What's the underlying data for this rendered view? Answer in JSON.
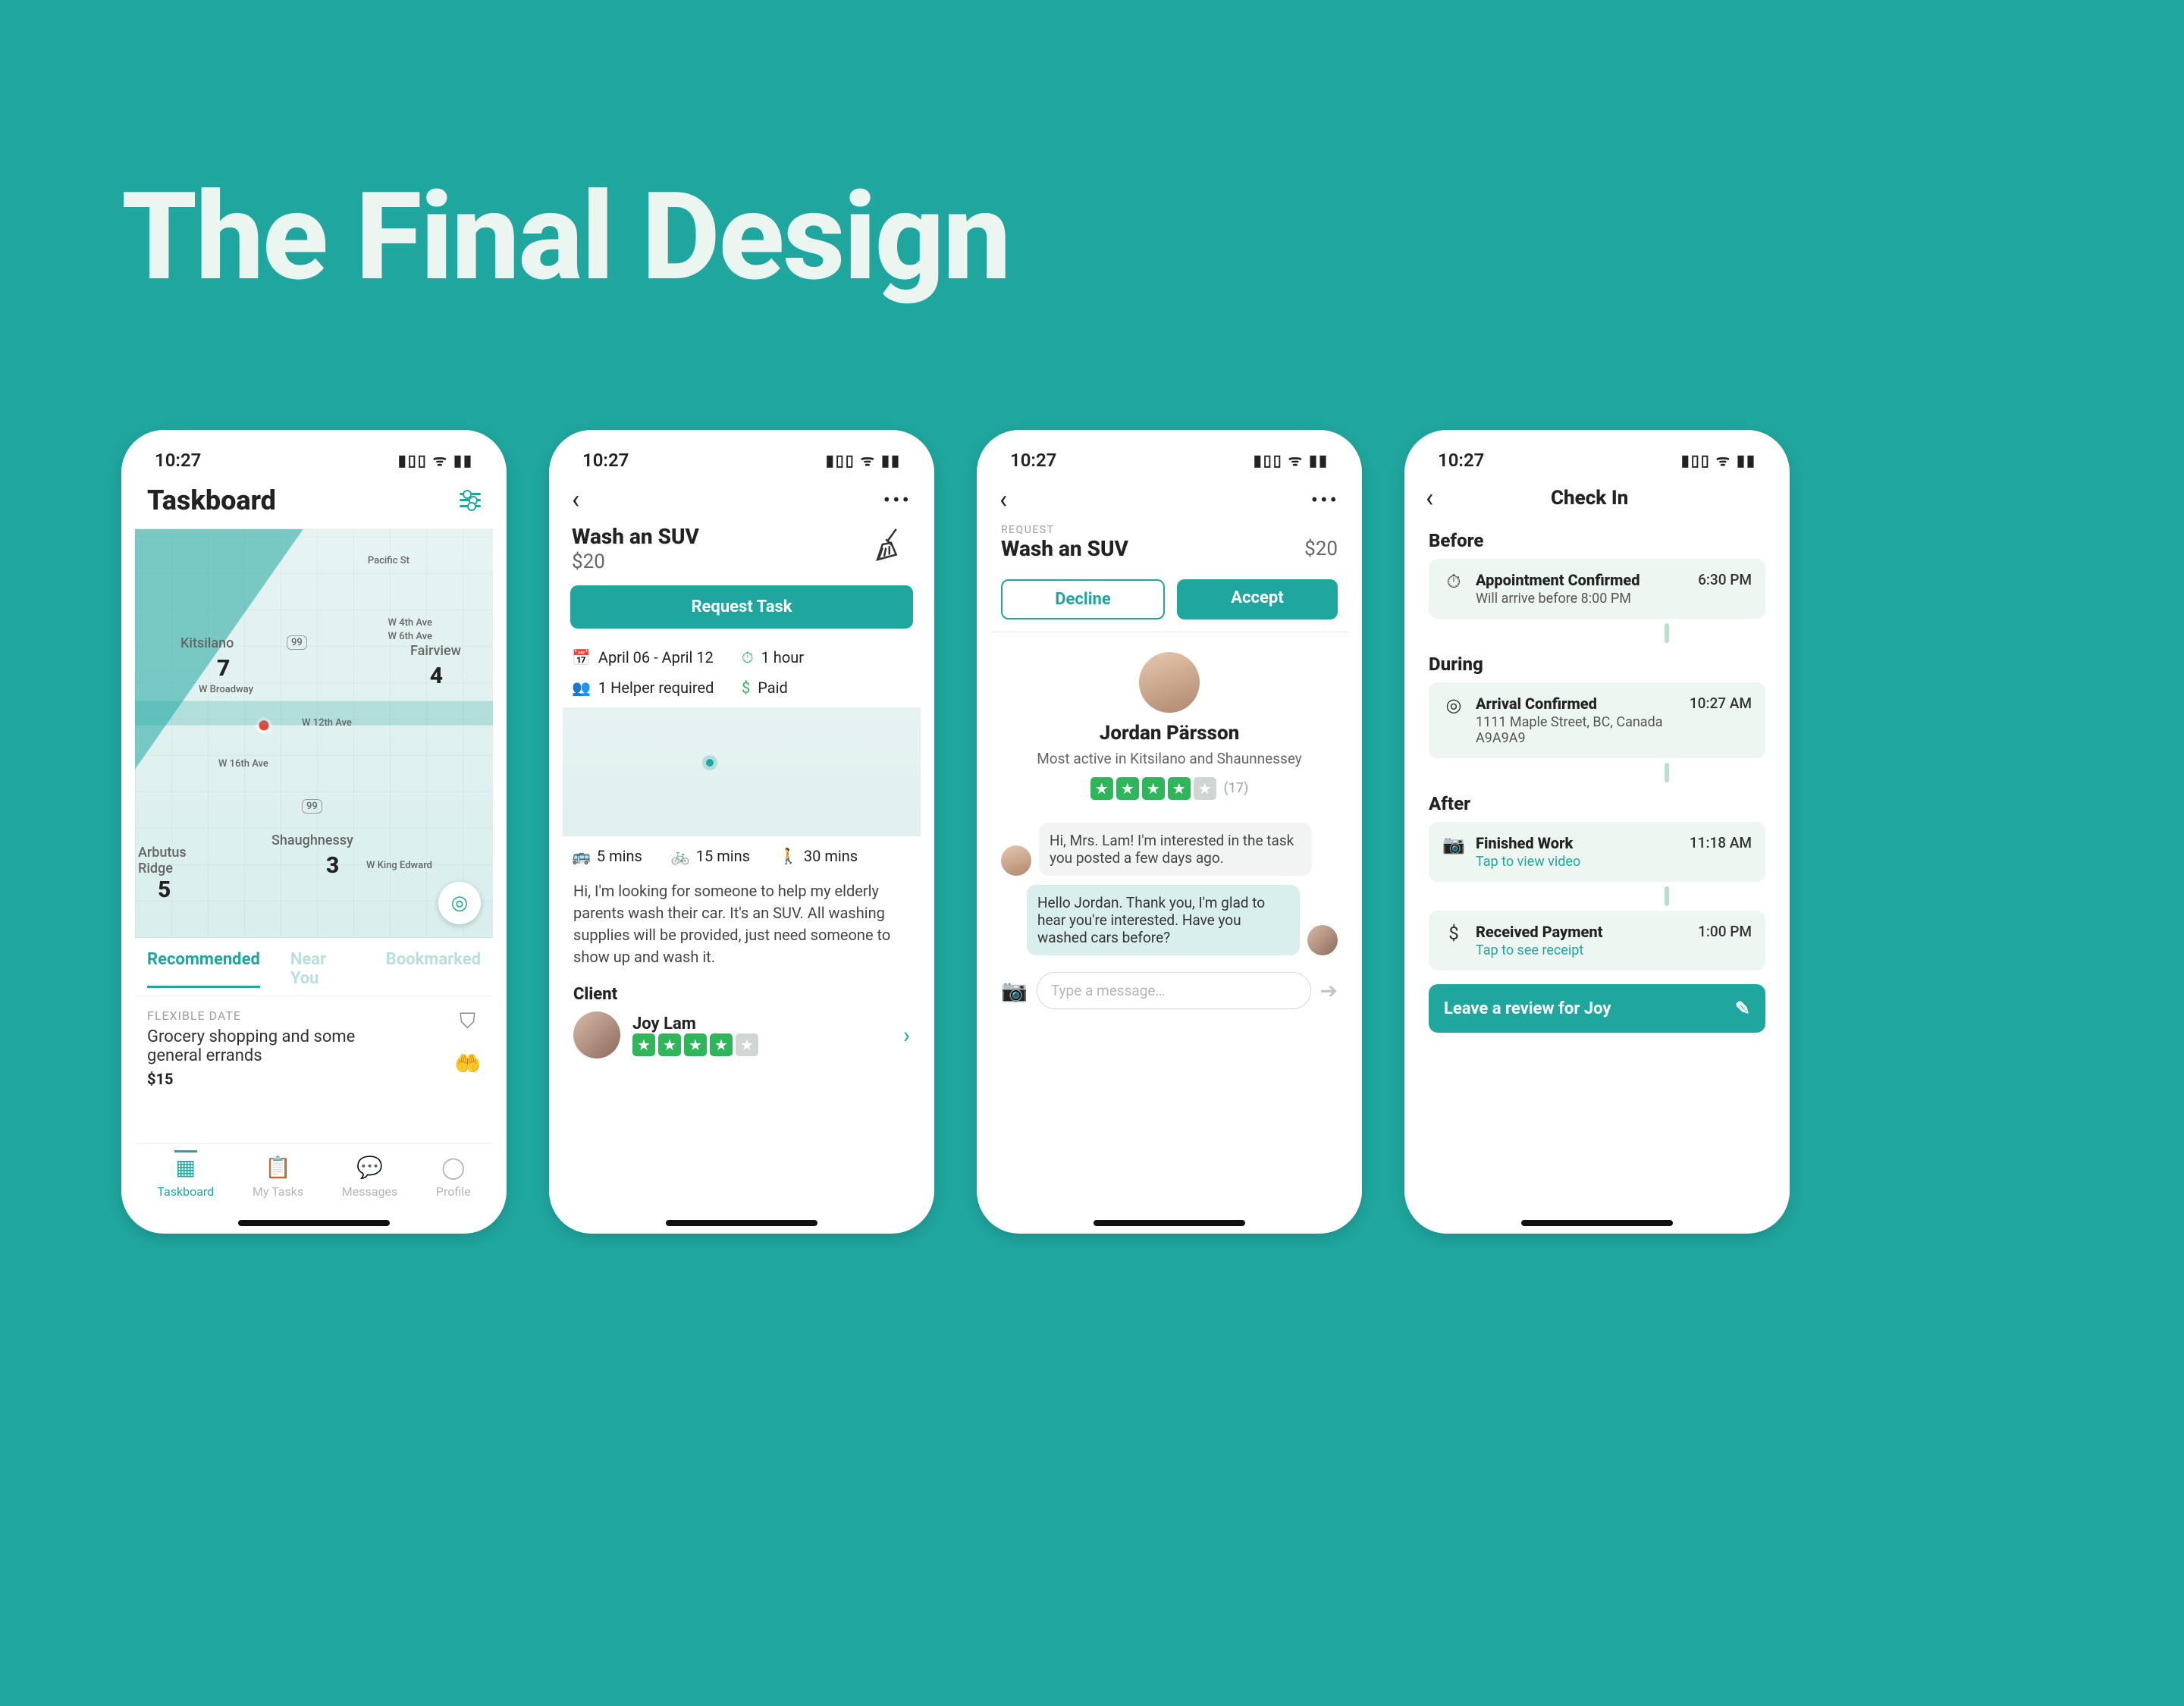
{
  "hero": "The Final Design",
  "status_time": "10:27",
  "screen1": {
    "title": "Taskboard",
    "map": {
      "areas": [
        {
          "name": "Kitsilano",
          "num": "7"
        },
        {
          "name": "Fairview",
          "num": "4"
        },
        {
          "name": "Shaughnessy",
          "num": "3"
        },
        {
          "name": "Arbutus Ridge",
          "num": "5"
        }
      ],
      "streets": [
        "Pacific St",
        "W 4th Ave",
        "W 6th Ave",
        "W Broadway",
        "W 12th Ave",
        "W 16th Ave",
        "W King Edward"
      ],
      "hwy": "99"
    },
    "tabs": [
      "Recommended",
      "Near You",
      "Bookmarked"
    ],
    "card": {
      "meta": "FLEXIBLE DATE",
      "title": "Grocery shopping and some general errands",
      "price": "$15"
    },
    "nav": [
      "Taskboard",
      "My Tasks",
      "Messages",
      "Profile"
    ]
  },
  "screen2": {
    "title": "Wash an SUV",
    "price": "$20",
    "cta": "Request Task",
    "info": {
      "dates": "April 06 - April 12",
      "duration": "1 hour",
      "helpers": "1 Helper required",
      "pay": "Paid"
    },
    "travel": {
      "bus": "5 mins",
      "bike": "15 mins",
      "walk": "30 mins"
    },
    "desc": "Hi, I'm looking for someone to help my elderly parents wash their car. It's an SUV. All washing supplies will be provided, just need someone to show up and wash it.",
    "client_h": "Client",
    "client_name": "Joy Lam",
    "rating": 4
  },
  "screen3": {
    "badge": "REQUEST",
    "title": "Wash an SUV",
    "price": "$20",
    "decline": "Decline",
    "accept": "Accept",
    "name": "Jordan Pärsson",
    "sub": "Most active in Kitsilano and Shaunnessey",
    "rating": 4,
    "count": "(17)",
    "msg_in": "Hi, Mrs. Lam! I'm interested in the task you posted a few days ago.",
    "msg_out": "Hello Jordan. Thank you, I'm glad to hear you're interested. Have you washed cars before?",
    "placeholder": "Type a message…"
  },
  "screen4": {
    "title": "Check In",
    "sections": {
      "before": "Before",
      "during": "During",
      "after": "After"
    },
    "steps": [
      {
        "title": "Appointment Confirmed",
        "sub": "Will arrive before 8:00 PM",
        "time": "6:30 PM"
      },
      {
        "title": "Arrival Confirmed",
        "sub": "1111 Maple Street, BC, Canada A9A9A9",
        "time": "10:27 AM"
      },
      {
        "title": "Finished Work",
        "link": "Tap to view video",
        "time": "11:18 AM"
      },
      {
        "title": "Received Payment",
        "link": "Tap to see receipt",
        "time": "1:00 PM"
      }
    ],
    "review": "Leave a review for Joy"
  }
}
